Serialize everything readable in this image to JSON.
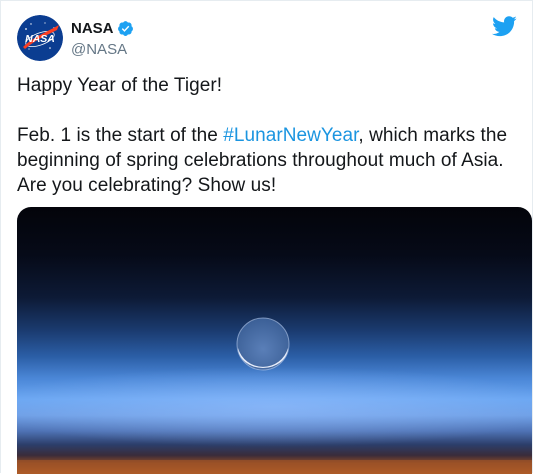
{
  "tweet": {
    "author": {
      "display_name": "NASA",
      "handle": "@NASA",
      "avatar_text": "NASA",
      "verified_icon": "verified-badge-icon"
    },
    "service_icon": "twitter-bird-icon",
    "body": {
      "line1": "Happy Year of the Tiger!",
      "line2_before": "Feb. 1 is the start of the ",
      "hashtag": "#LunarNewYear",
      "line2_after": ", which marks the beginning of spring celebrations throughout much of Asia. Are you celebrating? Show us!"
    },
    "media": {
      "kind": "photo",
      "subject": "crescent moon over Earth's horizon"
    }
  },
  "colors": {
    "text": "#14171a",
    "secondary": "#657786",
    "link": "#1b95e0",
    "verified": "#1da1f2",
    "twitter_blue": "#1da1f2",
    "nasa_blue": "#0b3d91",
    "nasa_red": "#fc3d21"
  }
}
